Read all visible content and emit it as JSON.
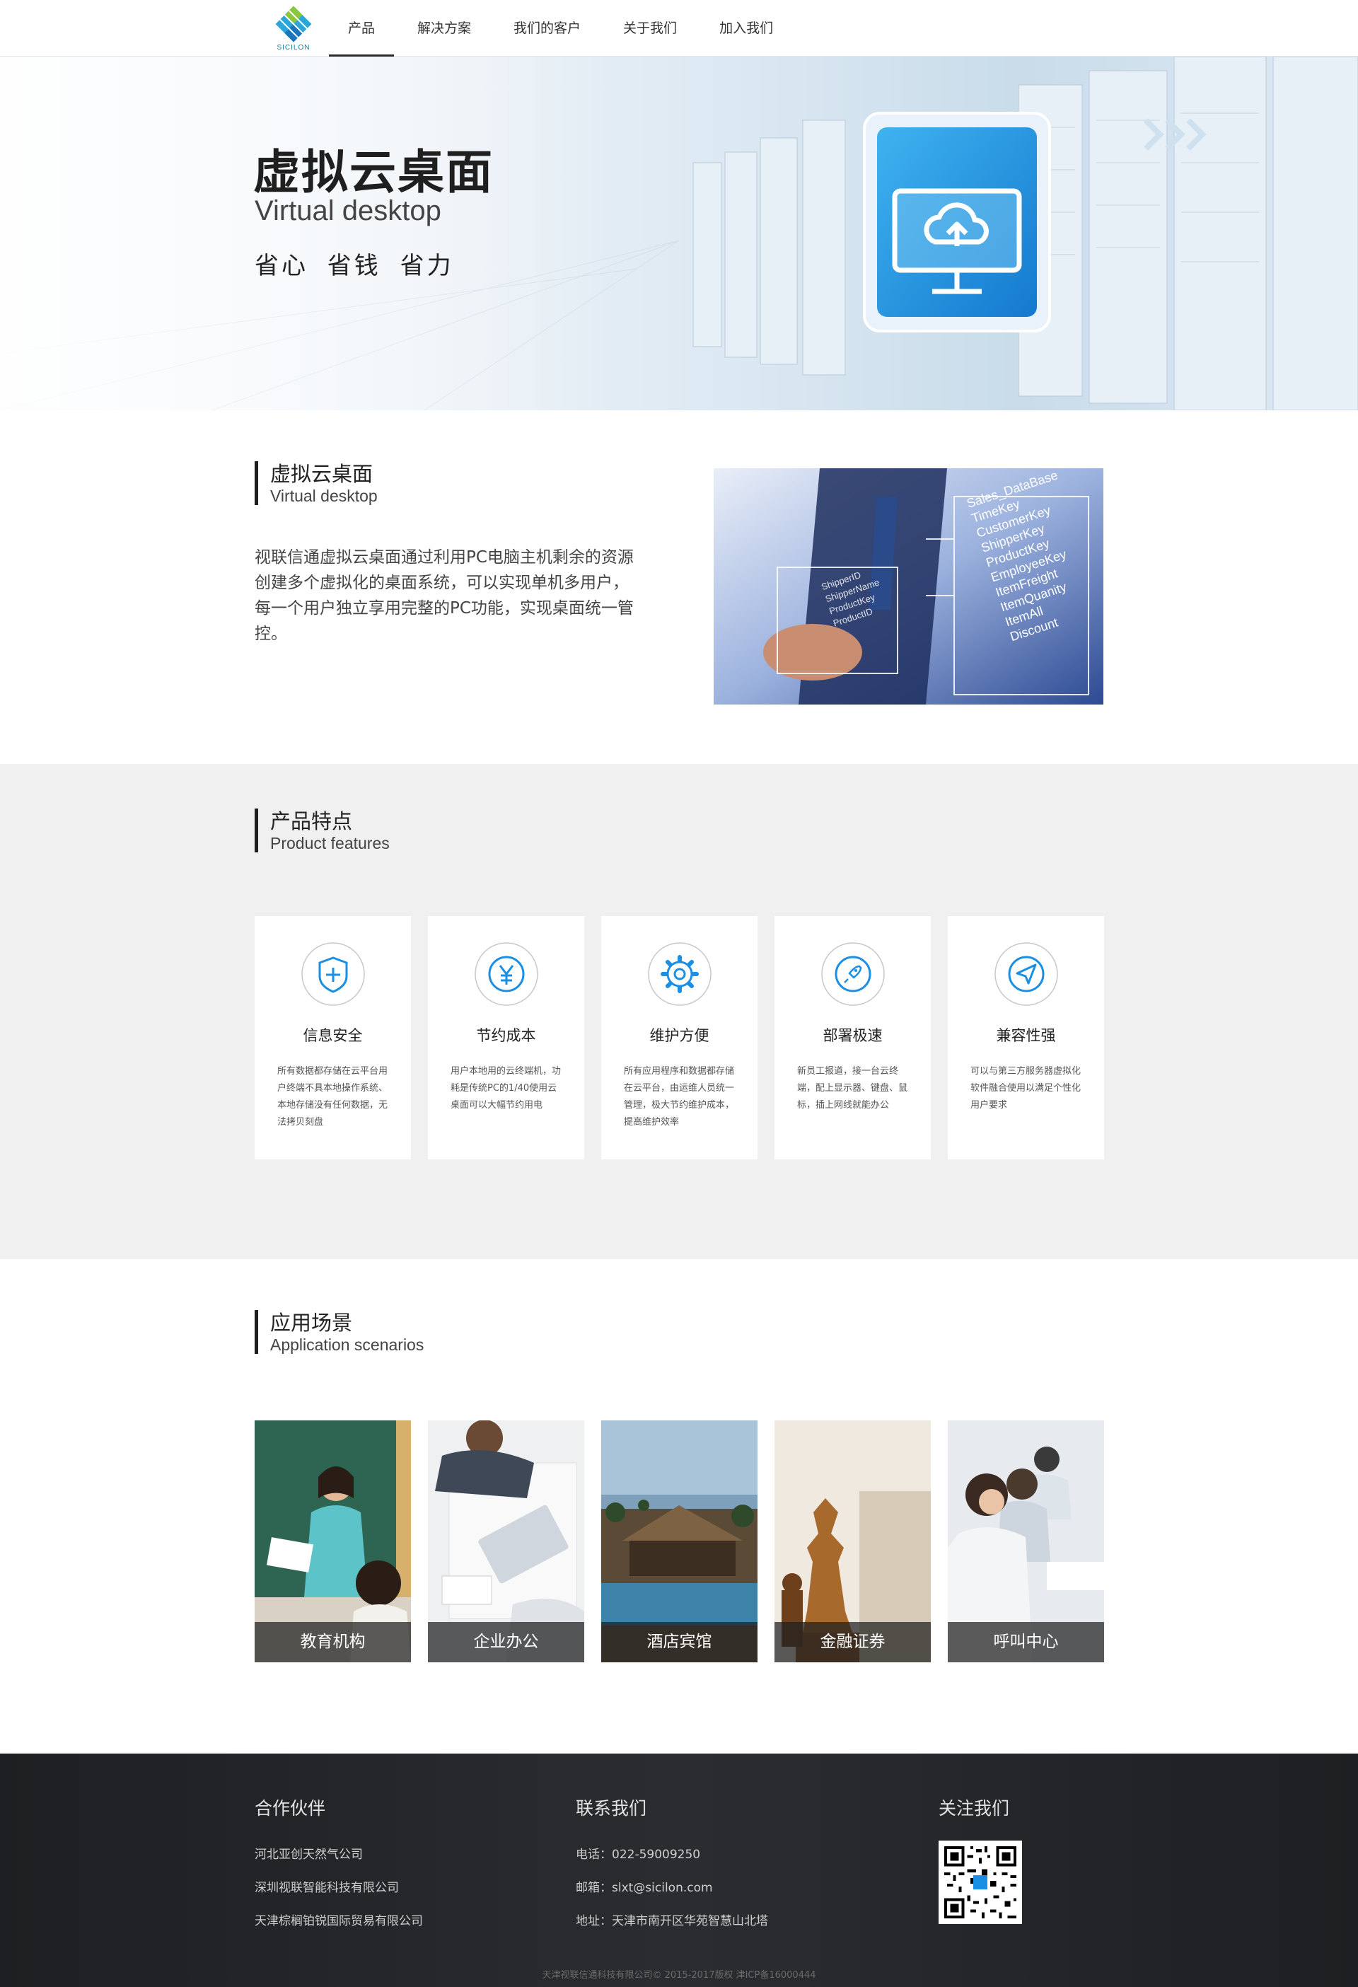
{
  "nav": {
    "logo_text": "SICILON",
    "items": [
      {
        "label": "产品",
        "active": true
      },
      {
        "label": "解决方案"
      },
      {
        "label": "我们的客户"
      },
      {
        "label": "关于我们"
      },
      {
        "label": "加入我们"
      }
    ]
  },
  "hero": {
    "title": "虚拟云桌面",
    "subtitle": "Virtual desktop",
    "slogan": "省心 省钱 省力"
  },
  "intro": {
    "heading_cn": "虚拟云桌面",
    "heading_en": "Virtual desktop",
    "text": "视联信通虚拟云桌面通过利用PC电脑主机剩余的资源创建多个虚拟化的桌面系统，可以实现单机多用户，每一个用户独立享用完整的PC功能，实现桌面统一管控。",
    "image_labels": [
      "Sales_DataBase",
      "TimeKey",
      "CustomerKey",
      "ShipperKey",
      "ProductKey",
      "EmployeeKey",
      "ItemFreight",
      "ItemQuanity",
      "ItemAll",
      "Discount",
      "ShipperID",
      "ShipperName",
      "ProductKey",
      "ProductID"
    ]
  },
  "features": {
    "heading_cn": "产品特点",
    "heading_en": "Product features",
    "accent_color": "#1a8fe3",
    "items": [
      {
        "icon": "shield-plus-icon",
        "title": "信息安全",
        "desc": "所有数据都存储在云平台用户终端不具本地操作系统、本地存储没有任何数据，无法拷贝刻盘"
      },
      {
        "icon": "yen-icon",
        "title": "节约成本",
        "desc": "用户本地用的云终端机，功耗是传统PC的1/40使用云桌面可以大幅节约用电"
      },
      {
        "icon": "gear-icon",
        "title": "维护方便",
        "desc": "所有应用程序和数据都存储在云平台，由运维人员统一管理，极大节约维护成本，提高维护效率"
      },
      {
        "icon": "rocket-icon",
        "title": "部署极速",
        "desc": "新员工报道，接一台云终端，配上显示器、键盘、鼠标，插上网线就能办公"
      },
      {
        "icon": "send-icon",
        "title": "兼容性强",
        "desc": "可以与第三方服务器虚拟化软件融合使用以满足个性化用户要求"
      }
    ]
  },
  "scenarios": {
    "heading_cn": "应用场景",
    "heading_en": "Application scenarios",
    "items": [
      {
        "label": "教育机构"
      },
      {
        "label": "企业办公"
      },
      {
        "label": "酒店宾馆"
      },
      {
        "label": "金融证券"
      },
      {
        "label": "呼叫中心"
      }
    ]
  },
  "footer": {
    "partners_title": "合作伙伴",
    "partners": [
      "河北亚创天然气公司",
      "深圳视联智能科技有限公司",
      "天津棕榈铂锐国际贸易有限公司"
    ],
    "contact_title": "联系我们",
    "contact": [
      "电话：022-59009250",
      "邮箱：slxt@sicilon.com",
      "地址：天津市南开区华苑智慧山北塔"
    ],
    "follow_title": "关注我们",
    "copyright": "天津视联信通科技有限公司© 2015-2017版权 津ICP备16000444"
  }
}
